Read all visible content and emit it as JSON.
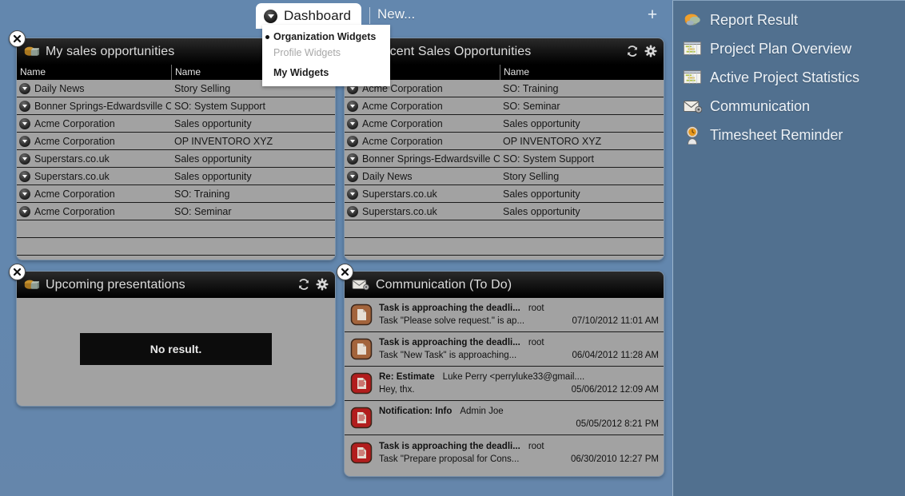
{
  "tabbar": {
    "active_tab": "Dashboard",
    "new_tab": "New...",
    "add_label": "+",
    "caret_icon": "chevron-down-icon",
    "plus_icon": "plus-icon"
  },
  "dropdown": {
    "items": [
      {
        "label": "Organization Widgets",
        "state": "selected"
      },
      {
        "label": "Profile Widgets",
        "state": "disabled"
      },
      {
        "label": "My Widgets",
        "state": "normal"
      }
    ]
  },
  "widgets": {
    "my_sales": {
      "title": "My sales opportunities",
      "icon": "cube-widget-icon",
      "close_icon": "close-icon",
      "columns": [
        "Name",
        "Name"
      ],
      "rows": [
        {
          "name": "Daily News",
          "opportunity": "Story Selling"
        },
        {
          "name": "Bonner Springs-Edwardsville Chie",
          "opportunity": "SO: System Support"
        },
        {
          "name": "Acme Corporation",
          "opportunity": "Sales opportunity"
        },
        {
          "name": "Acme Corporation",
          "opportunity": "OP INVENTORO XYZ"
        },
        {
          "name": "Superstars.co.uk",
          "opportunity": "Sales opportunity"
        },
        {
          "name": "Superstars.co.uk",
          "opportunity": "Sales opportunity"
        },
        {
          "name": "Acme Corporation",
          "opportunity": "SO: Training"
        },
        {
          "name": "Acme Corporation",
          "opportunity": "SO: Seminar"
        }
      ],
      "empty_rows": 2
    },
    "recent_sales": {
      "title": "Recent Sales Opportunities",
      "icon": "cube-widget-icon",
      "refresh_icon": "refresh-icon",
      "settings_icon": "gear-icon",
      "columns": [
        "Name",
        "Name"
      ],
      "rows": [
        {
          "name": "Acme Corporation",
          "opportunity": "SO: Training"
        },
        {
          "name": "Acme Corporation",
          "opportunity": "SO: Seminar"
        },
        {
          "name": "Acme Corporation",
          "opportunity": "Sales opportunity"
        },
        {
          "name": "Acme Corporation",
          "opportunity": "OP INVENTORO XYZ"
        },
        {
          "name": "Bonner Springs-Edwardsville Chie",
          "opportunity": "SO: System Support"
        },
        {
          "name": "Daily News",
          "opportunity": "Story Selling"
        },
        {
          "name": "Superstars.co.uk",
          "opportunity": "Sales opportunity"
        },
        {
          "name": "Superstars.co.uk",
          "opportunity": "Sales opportunity"
        }
      ],
      "empty_rows": 2
    },
    "upcoming": {
      "title": "Upcoming presentations",
      "icon": "cube-widget-icon",
      "close_icon": "close-icon",
      "refresh_icon": "refresh-icon",
      "settings_icon": "gear-icon",
      "empty_message": "No result."
    },
    "communication": {
      "title": "Communication (To Do)",
      "icon": "mail-icon",
      "close_icon": "close-icon",
      "items": [
        {
          "subject": "Task is approaching the deadli...",
          "from": "root",
          "preview": "Task \"Please solve request.\" is ap...",
          "date": "07/10/2012 11:01 AM",
          "icon": "task-document-icon",
          "icon_color": "#a3643c"
        },
        {
          "subject": "Task is approaching the deadli...",
          "from": "root",
          "preview": "Task \"New Task\" is approaching...",
          "date": "06/04/2012 11:28 AM",
          "icon": "task-document-icon",
          "icon_color": "#a3643c"
        },
        {
          "subject": "Re: Estimate",
          "from": "Luke Perry <perryluke33@gmail....",
          "preview": "Hey,  thx.",
          "date": "05/06/2012 12:09 AM",
          "icon": "message-document-icon",
          "icon_color": "#b21d1d"
        },
        {
          "subject": "Notification: Info",
          "from": "Admin  Joe",
          "preview": "",
          "date": "05/05/2012 8:21 PM",
          "icon": "message-document-icon",
          "icon_color": "#b21d1d"
        },
        {
          "subject": "Task is approaching the deadli...",
          "from": "root",
          "preview": "Task \"Prepare proposal for Cons...",
          "date": "06/30/2010 12:27 PM",
          "icon": "message-document-icon",
          "icon_color": "#b21d1d"
        }
      ]
    }
  },
  "sidebar": {
    "items": [
      {
        "label": "Report Result",
        "icon": "pie-chart-icon"
      },
      {
        "label": "Project Plan Overview",
        "icon": "gantt-chart-icon"
      },
      {
        "label": "Active Project Statistics",
        "icon": "gantt-chart-icon"
      },
      {
        "label": "Communication",
        "icon": "envelope-icon"
      },
      {
        "label": "Timesheet Reminder",
        "icon": "clock-person-icon"
      }
    ]
  },
  "colors": {
    "desktop_blue": "#6387ae",
    "sidebar_blue": "#51708f",
    "widget_body": "#a2a2a2",
    "widget_header": "#0d0d0d"
  }
}
